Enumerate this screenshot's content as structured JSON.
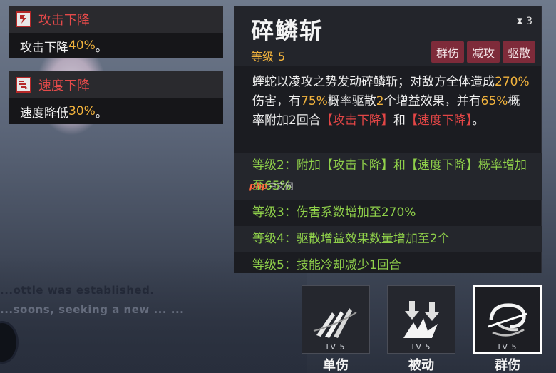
{
  "status_effects": [
    {
      "icon": "attack-down-icon",
      "title": "攻击下降",
      "desc_prefix": "攻击下降",
      "desc_value": "40%",
      "desc_suffix": "。"
    },
    {
      "icon": "speed-down-icon",
      "title": "速度下降",
      "desc_prefix": "速度降低",
      "desc_value": "30%",
      "desc_suffix": "。"
    }
  ],
  "skill": {
    "name": "碎鳞斩",
    "level_label": "等级",
    "level_value": "5",
    "cooldown_icon": "hourglass-icon",
    "cooldown": "3",
    "tags": [
      "群伤",
      "减攻",
      "驱散"
    ],
    "description": {
      "p1": "蝰蛇以凌攻之势发动碎鳞斩；对敌方全体造成",
      "v1": "270%",
      "p2": "伤害，有",
      "v2": "75%",
      "p3": "概率驱散",
      "v3": "2",
      "p4": "个增益效果，并有",
      "v4": "65%",
      "p5": "概率附加2回合",
      "r1": "【攻击下降】",
      "p6": "和",
      "r2": "【速度下降】",
      "p7": "。"
    },
    "upgrades": [
      "等级2：附加【攻击下降】和【速度下降】概率增加至65%",
      "等级3：伤害系数增加至270%",
      "等级4：驱散增益效果数量增加至2个",
      "等级5：技能冷却减少1回合"
    ]
  },
  "skill_buttons": [
    {
      "icon": "claw-slash-icon",
      "level": "LV 5",
      "label": "单伤",
      "selected": false
    },
    {
      "icon": "shatter-arrows-icon",
      "level": "LV 5",
      "label": "被动",
      "selected": false
    },
    {
      "icon": "spiral-slash-icon",
      "level": "LV 5",
      "label": "群伤",
      "selected": true
    }
  ],
  "background_text": [
    "...ottle was established.",
    "...soons, seeking a new ... ..."
  ],
  "watermark": {
    "logo": "php",
    "text": "中文网"
  },
  "colors": {
    "highlight_yellow": "#f2b33d",
    "highlight_red": "#e34646",
    "upgrade_green": "#8fd04a",
    "tag_bg": "#7e2b3a"
  }
}
